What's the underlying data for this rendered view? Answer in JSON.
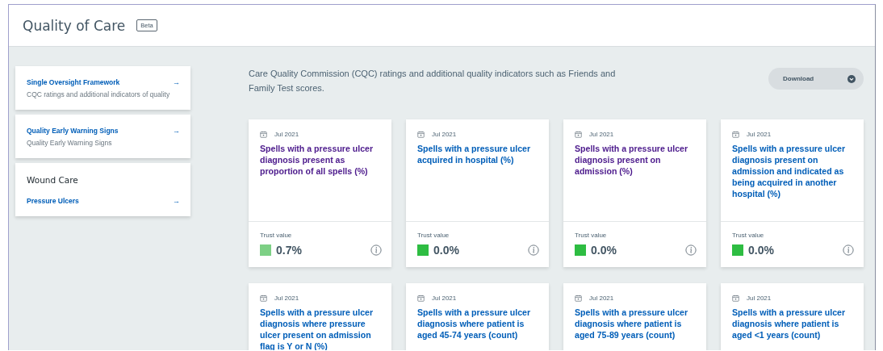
{
  "header": {
    "title": "Quality of Care",
    "badge": "Beta"
  },
  "sidebar": {
    "items": [
      {
        "title": "Single Oversight Framework",
        "subtitle": "CQC ratings and additional indicators of quality",
        "arrow": "→"
      },
      {
        "title": "Quality Early Warning Signs",
        "subtitle": "Quality Early Warning Signs",
        "arrow": "→"
      }
    ],
    "section": {
      "heading": "Wound Care",
      "links": [
        {
          "title": "Pressure Ulcers",
          "arrow": "→"
        }
      ]
    }
  },
  "intro": "Care Quality Commission (CQC) ratings and additional quality indicators such as Friends and Family Test scores.",
  "download_button": "Download",
  "cards": [
    {
      "date": "Jul 2021",
      "title": "Spells with a pressure ulcer diagnosis present as proportion of all spells (%)",
      "visited": true,
      "value_label": "Trust value",
      "value": "0.7%",
      "color": "#7dd085"
    },
    {
      "date": "Jul 2021",
      "title": "Spells with a pressure ulcer acquired in hospital (%)",
      "visited": false,
      "value_label": "Trust value",
      "value": "0.0%",
      "color": "#2ebd42"
    },
    {
      "date": "Jul 2021",
      "title": "Spells with a pressure ulcer diagnosis present on admission (%)",
      "visited": true,
      "value_label": "Trust value",
      "value": "0.0%",
      "color": "#2ebd42"
    },
    {
      "date": "Jul 2021",
      "title": "Spells with a pressure ulcer diagnosis present on admission and indicated as being acquired in another hospital (%)",
      "visited": false,
      "value_label": "Trust value",
      "value": "0.0%",
      "color": "#2ebd42"
    },
    {
      "date": "Jul 2021",
      "title": "Spells with a pressure ulcer diagnosis where pressure ulcer present on admission flag is Y or N (%)",
      "visited": false
    },
    {
      "date": "Jul 2021",
      "title": "Spells with a pressure ulcer diagnosis where patient is aged 45-74 years (count)",
      "visited": false
    },
    {
      "date": "Jul 2021",
      "title": "Spells with a pressure ulcer diagnosis where patient is aged 75-89 years (count)",
      "visited": false
    },
    {
      "date": "Jul 2021",
      "title": "Spells with a pressure ulcer diagnosis where patient is aged <1 years (count)",
      "visited": false
    }
  ]
}
